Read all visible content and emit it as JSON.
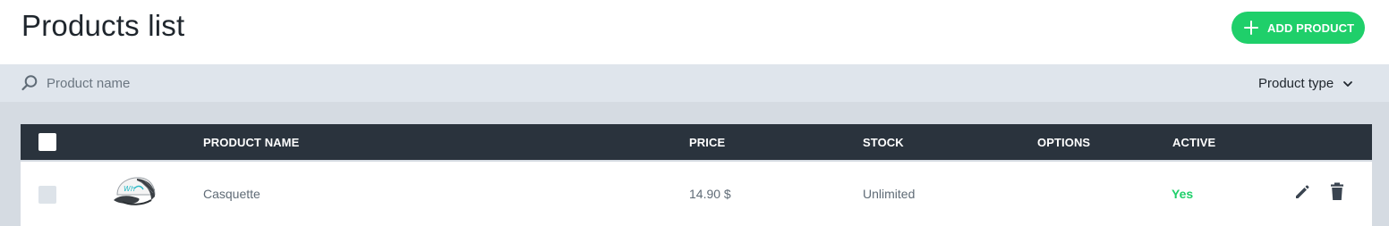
{
  "header": {
    "title": "Products list",
    "add_button_label": "ADD PRODUCT"
  },
  "filters": {
    "search_placeholder": "Product name",
    "search_value": "",
    "product_type_label": "Product type"
  },
  "table": {
    "columns": [
      "PRODUCT NAME",
      "PRICE",
      "STOCK",
      "OPTIONS",
      "ACTIVE"
    ],
    "rows": [
      {
        "name": "Casquette",
        "price": "14.90 $",
        "stock": "Unlimited",
        "options": "",
        "active": "Yes",
        "image": "cap-thumbnail"
      }
    ]
  },
  "colors": {
    "accent_green": "#1fcf6a",
    "table_header_bg": "#2a333d",
    "filter_bar_bg": "#dfe5ec",
    "content_bg": "#d5dbe2"
  },
  "icons": {
    "add": "plus-icon",
    "search": "search-icon",
    "dropdown": "chevron-down-icon",
    "edit": "pencil-icon",
    "delete": "trash-icon"
  }
}
